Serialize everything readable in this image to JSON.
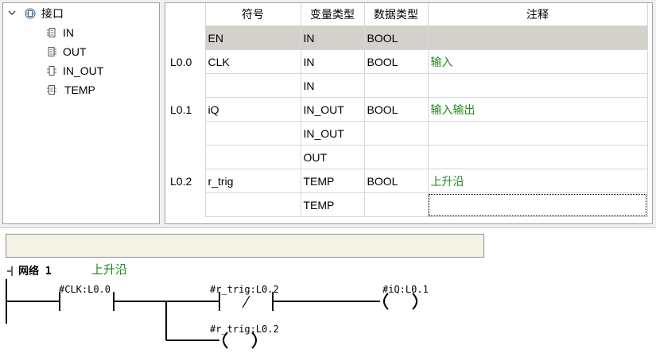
{
  "tree": {
    "root": {
      "label": "接口",
      "icon": "interface-icon",
      "expanded": true
    },
    "items": [
      {
        "label": "IN",
        "icon": "in-section-icon"
      },
      {
        "label": "OUT",
        "icon": "out-section-icon"
      },
      {
        "label": "IN_OUT",
        "icon": "inout-section-icon"
      },
      {
        "label": "TEMP",
        "icon": "temp-section-icon"
      }
    ]
  },
  "table": {
    "headers": {
      "symbol": "符号",
      "var_type": "变量类型",
      "data_type": "数据类型",
      "comment": "注释"
    },
    "rows": [
      {
        "addr": "",
        "symbol": "EN",
        "var_type": "IN",
        "data_type": "BOOL",
        "comment": ""
      },
      {
        "addr": "L0.0",
        "symbol": "CLK",
        "var_type": "IN",
        "data_type": "BOOL",
        "comment": "输入"
      },
      {
        "addr": "",
        "symbol": "",
        "var_type": "IN",
        "data_type": "",
        "comment": ""
      },
      {
        "addr": "L0.1",
        "symbol": "iQ",
        "var_type": "IN_OUT",
        "data_type": "BOOL",
        "comment": "输入输出"
      },
      {
        "addr": "",
        "symbol": "",
        "var_type": "IN_OUT",
        "data_type": "",
        "comment": ""
      },
      {
        "addr": "",
        "symbol": "",
        "var_type": "OUT",
        "data_type": "",
        "comment": ""
      },
      {
        "addr": "L0.2",
        "symbol": "r_trig",
        "var_type": "TEMP",
        "data_type": "BOOL",
        "comment": "上升沿"
      },
      {
        "addr": "",
        "symbol": "",
        "var_type": "TEMP",
        "data_type": "",
        "comment": ""
      }
    ],
    "selected_row": 0,
    "focused_cell": "row 8 comment",
    "comment_color": "#1e8a1e",
    "selected_color": "#d4d0cc"
  },
  "network": {
    "title": "",
    "label": "网络 1",
    "comment": "上升沿",
    "collapse_icon": "network-collapse-icon",
    "contacts": [
      {
        "operand": "#CLK:L0.0",
        "kind": "normally-open"
      },
      {
        "operand": "#r_trig:L0.2",
        "kind": "normally-closed"
      }
    ],
    "coils": [
      {
        "operand": "#iQ:L0.1",
        "kind": "coil"
      },
      {
        "operand": "#r_trig:L0.2",
        "kind": "coil"
      }
    ]
  }
}
